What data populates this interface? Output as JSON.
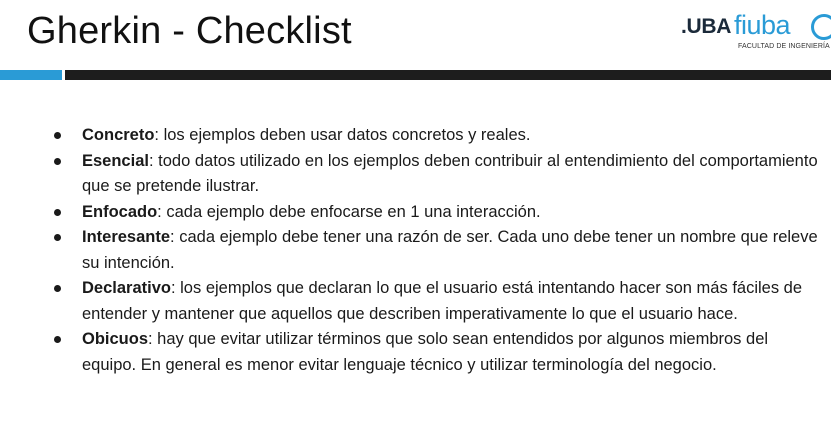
{
  "slide": {
    "title": "Gherkin - Checklist",
    "logo": {
      "uba": ".UBA",
      "fiuba": "fiuba",
      "subtitle": "FACULTAD DE INGENIERÍA"
    },
    "colors": {
      "accent": "#2a9bd6",
      "bar_dark": "#1d1d1d"
    },
    "items": [
      {
        "term": "Concreto",
        "text": ": los ejemplos deben usar datos concretos y reales."
      },
      {
        "term": "Esencial",
        "text": ": todo datos utilizado en los ejemplos deben contribuir al entendimiento del comportamiento que se pretende ilustrar."
      },
      {
        "term": "Enfocado",
        "text": ": cada ejemplo debe enfocarse en 1 una interacción."
      },
      {
        "term": "Interesante",
        "text": ": cada ejemplo debe tener una razón de ser. Cada uno debe tener un nombre que releve su intención."
      },
      {
        "term": "Declarativo",
        "text": ": los ejemplos que declaran lo que el usuario está intentando hacer son más fáciles de entender y mantener que aquellos que describen imperativamente lo que el usuario hace."
      },
      {
        "term": "Obicuos",
        "text": ": hay que evitar utilizar términos que solo sean entendidos por algunos miembros del equipo. En general es menor evitar lenguaje técnico y utilizar terminología del negocio."
      }
    ]
  }
}
